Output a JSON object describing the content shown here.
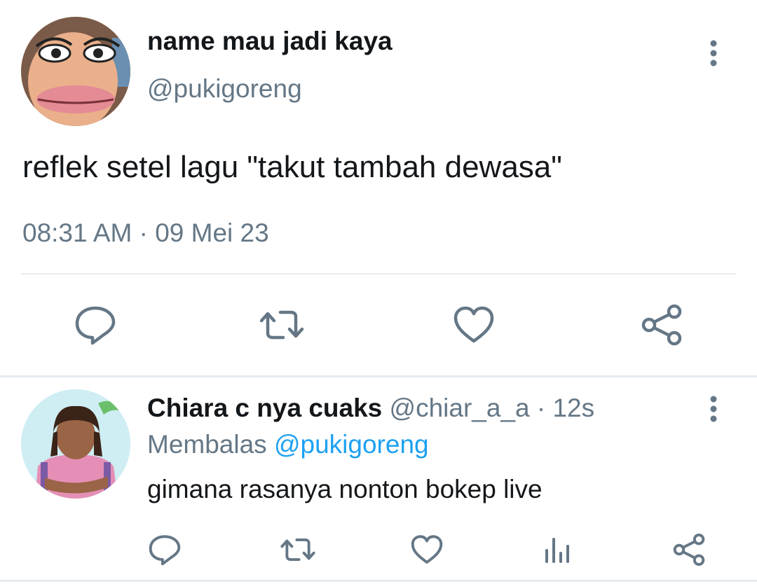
{
  "main_tweet": {
    "display_name": "name mau jadi kaya",
    "handle": "@pukigoreng",
    "text": "reflek setel lagu \"takut tambah dewasa\"",
    "timestamp": "08:31 AM · 09 Mei 23",
    "more_icon": "more-vertical-icon",
    "actions": [
      "reply-icon",
      "retweet-icon",
      "like-icon",
      "share-icon"
    ]
  },
  "reply": {
    "display_name": "Chiara c nya cuaks",
    "handle_time": "@chiar_a_a · 12s",
    "replying_prefix": "Membalas",
    "replying_to": "@pukigoreng",
    "text": "gimana rasanya nonton bokep live",
    "more_icon": "more-vertical-icon",
    "actions": [
      "reply-icon",
      "retweet-icon",
      "like-icon",
      "analytics-icon",
      "share-icon"
    ]
  },
  "colors": {
    "text": "#14171a",
    "secondary": "#657786",
    "accent": "#1da1f2",
    "divider": "#e6ecf0"
  }
}
